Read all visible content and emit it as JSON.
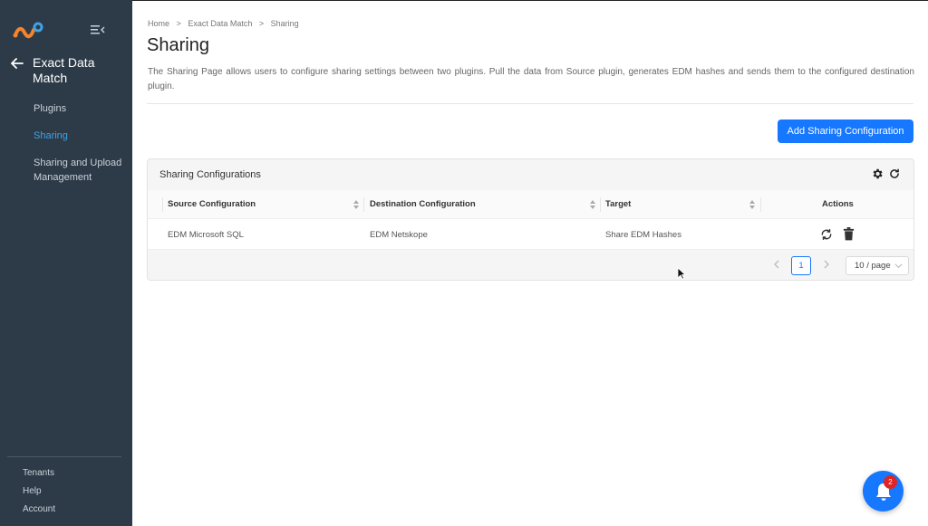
{
  "sidebar": {
    "back_title": "Exact Data Match",
    "items": [
      {
        "label": "Plugins",
        "active": false
      },
      {
        "label": "Sharing",
        "active": true
      },
      {
        "label": "Sharing and Upload Management",
        "active": false
      }
    ],
    "bottom_items": [
      "Tenants",
      "Help",
      "Account"
    ]
  },
  "breadcrumb": [
    "Home",
    ">",
    "Exact Data Match",
    ">",
    "Sharing"
  ],
  "page": {
    "title": "Sharing",
    "description": "The Sharing Page allows users to configure sharing settings between two plugins. Pull the data from Source plugin, generates EDM hashes and sends them to the configured destination plugin.",
    "add_button": "Add Sharing Configuration"
  },
  "card": {
    "title": "Sharing Configurations",
    "columns": [
      "Source Configuration",
      "Destination Configuration",
      "Target",
      "Actions"
    ],
    "rows": [
      {
        "source": "EDM Microsoft SQL",
        "destination": "EDM Netskope",
        "target": "Share EDM Hashes"
      }
    ]
  },
  "pagination": {
    "current": "1",
    "page_size": "10 / page"
  },
  "notifications": {
    "count": "2"
  },
  "colors": {
    "sidebar_bg": "#2d3b48",
    "accent": "#1677ff",
    "active_nav": "#3fa2e6",
    "badge": "#e02424"
  }
}
